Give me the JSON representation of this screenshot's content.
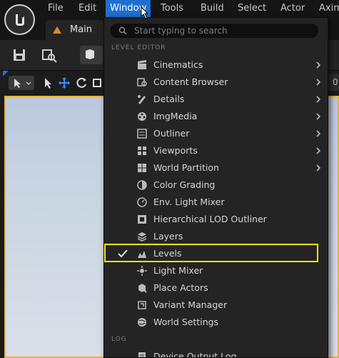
{
  "menubar": {
    "items": [
      "File",
      "Edit",
      "Window",
      "Tools",
      "Build",
      "Select",
      "Actor",
      "Axim"
    ],
    "active": "Window"
  },
  "tab": {
    "label": "Main"
  },
  "viewport": {
    "number_readout": "0"
  },
  "window_menu": {
    "search_placeholder": "Start typing to search",
    "sections": {
      "level_editor": "LEVEL EDITOR",
      "log": "LOG"
    },
    "items": [
      {
        "label": "Cinematics",
        "icon": "cinematics-icon",
        "submenu": true
      },
      {
        "label": "Content Browser",
        "icon": "content-browser-icon",
        "submenu": true
      },
      {
        "label": "Details",
        "icon": "details-icon",
        "submenu": true
      },
      {
        "label": "ImgMedia",
        "icon": "imgmedia-icon",
        "submenu": true
      },
      {
        "label": "Outliner",
        "icon": "outliner-icon",
        "submenu": true
      },
      {
        "label": "Viewports",
        "icon": "viewports-icon",
        "submenu": true
      },
      {
        "label": "World Partition",
        "icon": "world-partition-icon",
        "submenu": true
      },
      {
        "label": "Color Grading",
        "icon": "color-grading-icon",
        "submenu": false
      },
      {
        "label": "Env. Light Mixer",
        "icon": "env-light-mixer-icon",
        "submenu": false
      },
      {
        "label": "Hierarchical LOD Outliner",
        "icon": "hlod-outliner-icon",
        "submenu": false
      },
      {
        "label": "Layers",
        "icon": "layers-icon",
        "submenu": false
      },
      {
        "label": "Levels",
        "icon": "levels-icon",
        "submenu": false,
        "checked": true
      },
      {
        "label": "Light Mixer",
        "icon": "light-mixer-icon",
        "submenu": false
      },
      {
        "label": "Place Actors",
        "icon": "place-actors-icon",
        "submenu": false
      },
      {
        "label": "Variant Manager",
        "icon": "variant-manager-icon",
        "submenu": false
      },
      {
        "label": "World Settings",
        "icon": "world-settings-icon",
        "submenu": false
      }
    ],
    "log_items": [
      {
        "label": "Device Output Log",
        "icon": "device-output-log-icon"
      }
    ]
  },
  "colors": {
    "accent": "#1f6fd1",
    "highlight": "#ffe500",
    "viewport_border": "#e6b23a"
  }
}
